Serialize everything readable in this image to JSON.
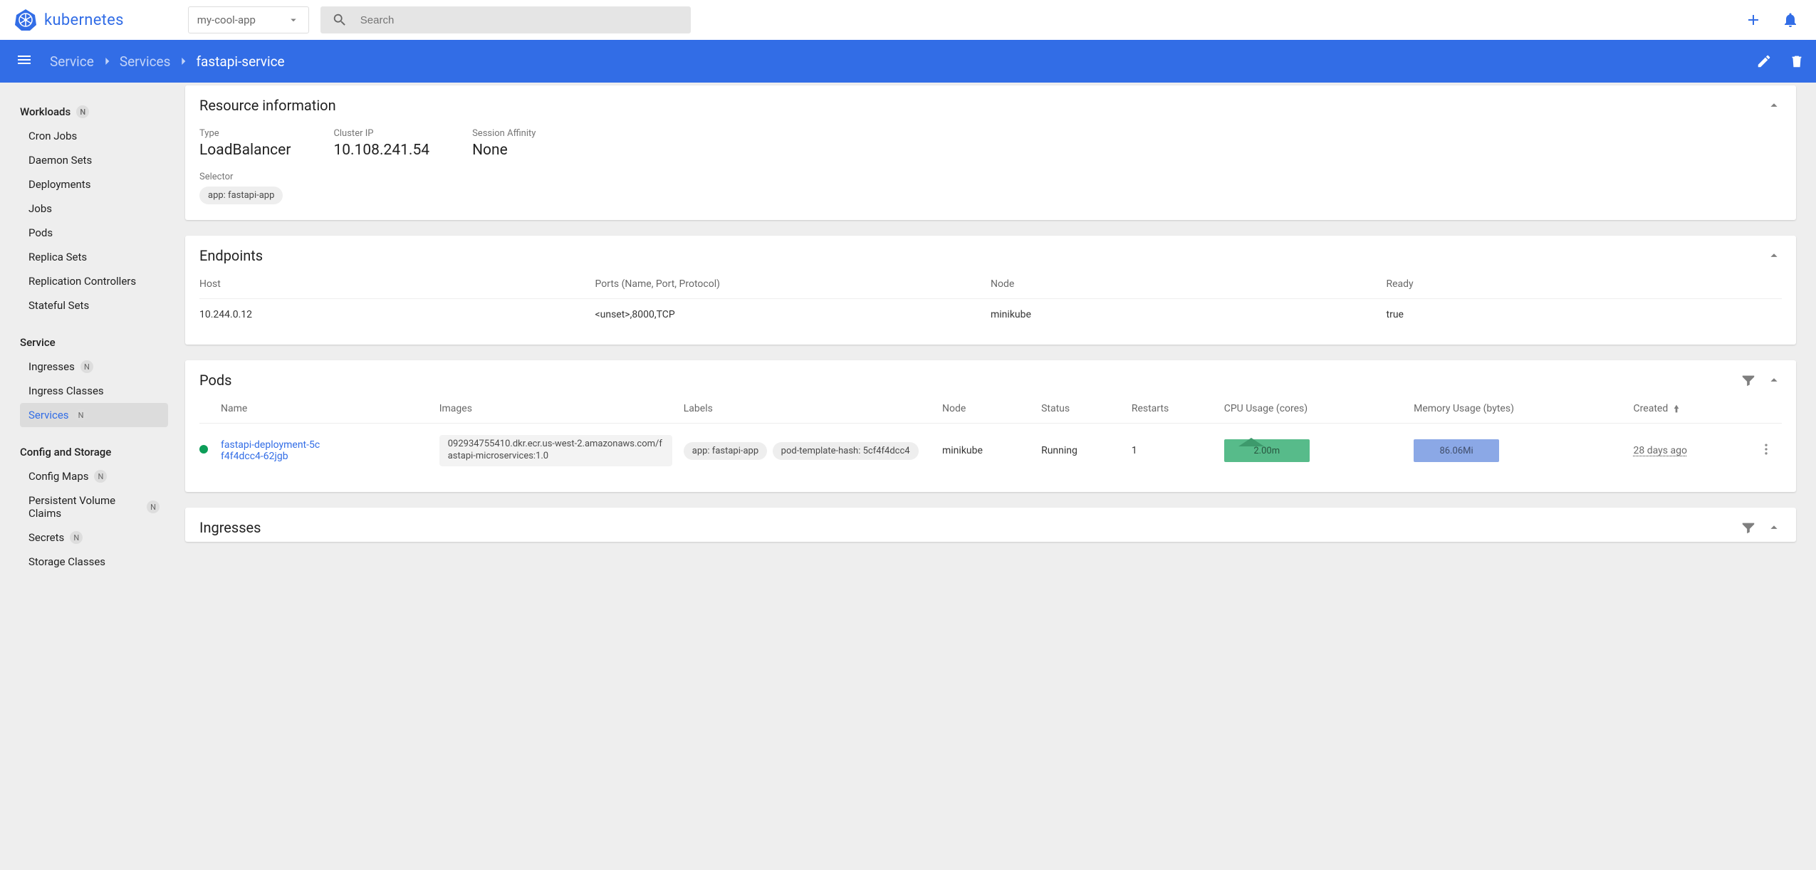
{
  "header": {
    "brand": "kubernetes",
    "namespace": "my-cool-app",
    "search_placeholder": "Search"
  },
  "breadcrumb": {
    "root": "Service",
    "mid": "Services",
    "leaf": "fastapi-service"
  },
  "sidebar": {
    "workloads": {
      "title": "Workloads",
      "badge": "N",
      "items": [
        "Cron Jobs",
        "Daemon Sets",
        "Deployments",
        "Jobs",
        "Pods",
        "Replica Sets",
        "Replication Controllers",
        "Stateful Sets"
      ]
    },
    "service": {
      "title": "Service",
      "ingresses": "Ingresses",
      "ingresses_badge": "N",
      "ingress_classes": "Ingress Classes",
      "services": "Services",
      "services_badge": "N"
    },
    "config": {
      "title": "Config and Storage",
      "config_maps": "Config Maps",
      "config_maps_badge": "N",
      "pvcs": "Persistent Volume Claims",
      "pvcs_badge": "N",
      "secrets": "Secrets",
      "secrets_badge": "N",
      "storage_classes": "Storage Classes"
    }
  },
  "resource_info": {
    "title": "Resource information",
    "type_label": "Type",
    "type_value": "LoadBalancer",
    "cluster_ip_label": "Cluster IP",
    "cluster_ip_value": "10.108.241.54",
    "session_affinity_label": "Session Affinity",
    "session_affinity_value": "None",
    "selector_label": "Selector",
    "selector_chip": "app: fastapi-app"
  },
  "endpoints": {
    "title": "Endpoints",
    "headers": {
      "host": "Host",
      "ports": "Ports (Name, Port, Protocol)",
      "node": "Node",
      "ready": "Ready"
    },
    "rows": [
      {
        "host": "10.244.0.12",
        "ports": "<unset>,8000,TCP",
        "node": "minikube",
        "ready": "true"
      }
    ]
  },
  "pods": {
    "title": "Pods",
    "headers": {
      "name": "Name",
      "images": "Images",
      "labels": "Labels",
      "node": "Node",
      "status": "Status",
      "restarts": "Restarts",
      "cpu": "CPU Usage (cores)",
      "mem": "Memory Usage (bytes)",
      "created": "Created"
    },
    "rows": [
      {
        "name": "fastapi-deployment-5cf4f4dcc4-62jgb",
        "image": "092934755410.dkr.ecr.us-west-2.amazonaws.com/fastapi-microservices:1.0",
        "label1": "app: fastapi-app",
        "label2": "pod-template-hash: 5cf4f4dcc4",
        "node": "minikube",
        "status": "Running",
        "restarts": "1",
        "cpu": "2.00m",
        "mem": "86.06Mi",
        "created": "28 days ago"
      }
    ]
  },
  "ingresses_card": {
    "title": "Ingresses"
  }
}
